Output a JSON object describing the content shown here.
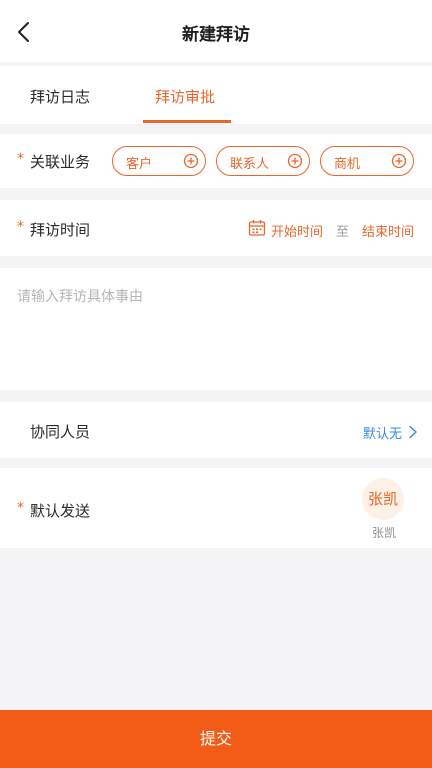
{
  "header": {
    "title": "新建拜访",
    "back_icon": "chevron-left-icon"
  },
  "tabs": [
    {
      "label": "拜访日志",
      "active": false
    },
    {
      "label": "拜访审批",
      "active": true
    }
  ],
  "related": {
    "required_mark": "*",
    "label": "关联业务",
    "chips": [
      {
        "label": "客户",
        "icon": "plus-circle-icon"
      },
      {
        "label": "联系人",
        "icon": "plus-circle-icon"
      },
      {
        "label": "商机",
        "icon": "plus-circle-icon"
      }
    ]
  },
  "visit_time": {
    "required_mark": "*",
    "label": "拜访时间",
    "icon": "calendar-icon",
    "start_placeholder": "开始时间",
    "separator": "至",
    "end_placeholder": "结束时间"
  },
  "reason": {
    "placeholder": "请输入拜访具体事由"
  },
  "collaborators": {
    "label": "协同人员",
    "value": "默认无",
    "icon": "chevron-right-icon"
  },
  "send_to": {
    "required_mark": "*",
    "label": "默认发送",
    "avatar_text": "张凯",
    "name": "张凯"
  },
  "footer": {
    "submit_label": "提交"
  },
  "colors": {
    "accent": "#e8672a",
    "submit_bg": "#f25c16",
    "link": "#3a8bd8"
  }
}
